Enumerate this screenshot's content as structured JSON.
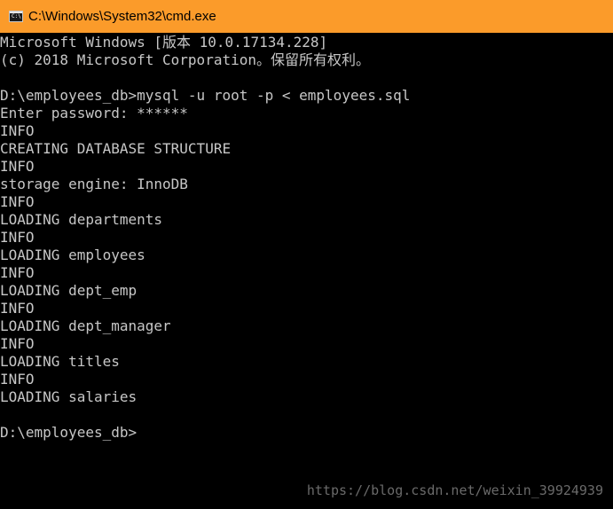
{
  "window": {
    "title": "C:\\Windows\\System32\\cmd.exe",
    "icon": "cmd-icon",
    "icon_glyph": "C:\\",
    "titlebar_color": "#fb9b2a"
  },
  "console": {
    "text_color": "#c7c7c7",
    "background": "#000000",
    "lines": [
      "Microsoft Windows [版本 10.0.17134.228]",
      "(c) 2018 Microsoft Corporation。保留所有权利。",
      "",
      "D:\\employees_db>mysql -u root -p < employees.sql",
      "Enter password: ******",
      "INFO",
      "CREATING DATABASE STRUCTURE",
      "INFO",
      "storage engine: InnoDB",
      "INFO",
      "LOADING departments",
      "INFO",
      "LOADING employees",
      "INFO",
      "LOADING dept_emp",
      "INFO",
      "LOADING dept_manager",
      "INFO",
      "LOADING titles",
      "INFO",
      "LOADING salaries",
      "",
      "D:\\employees_db>"
    ]
  },
  "watermark": "https://blog.csdn.net/weixin_39924939"
}
